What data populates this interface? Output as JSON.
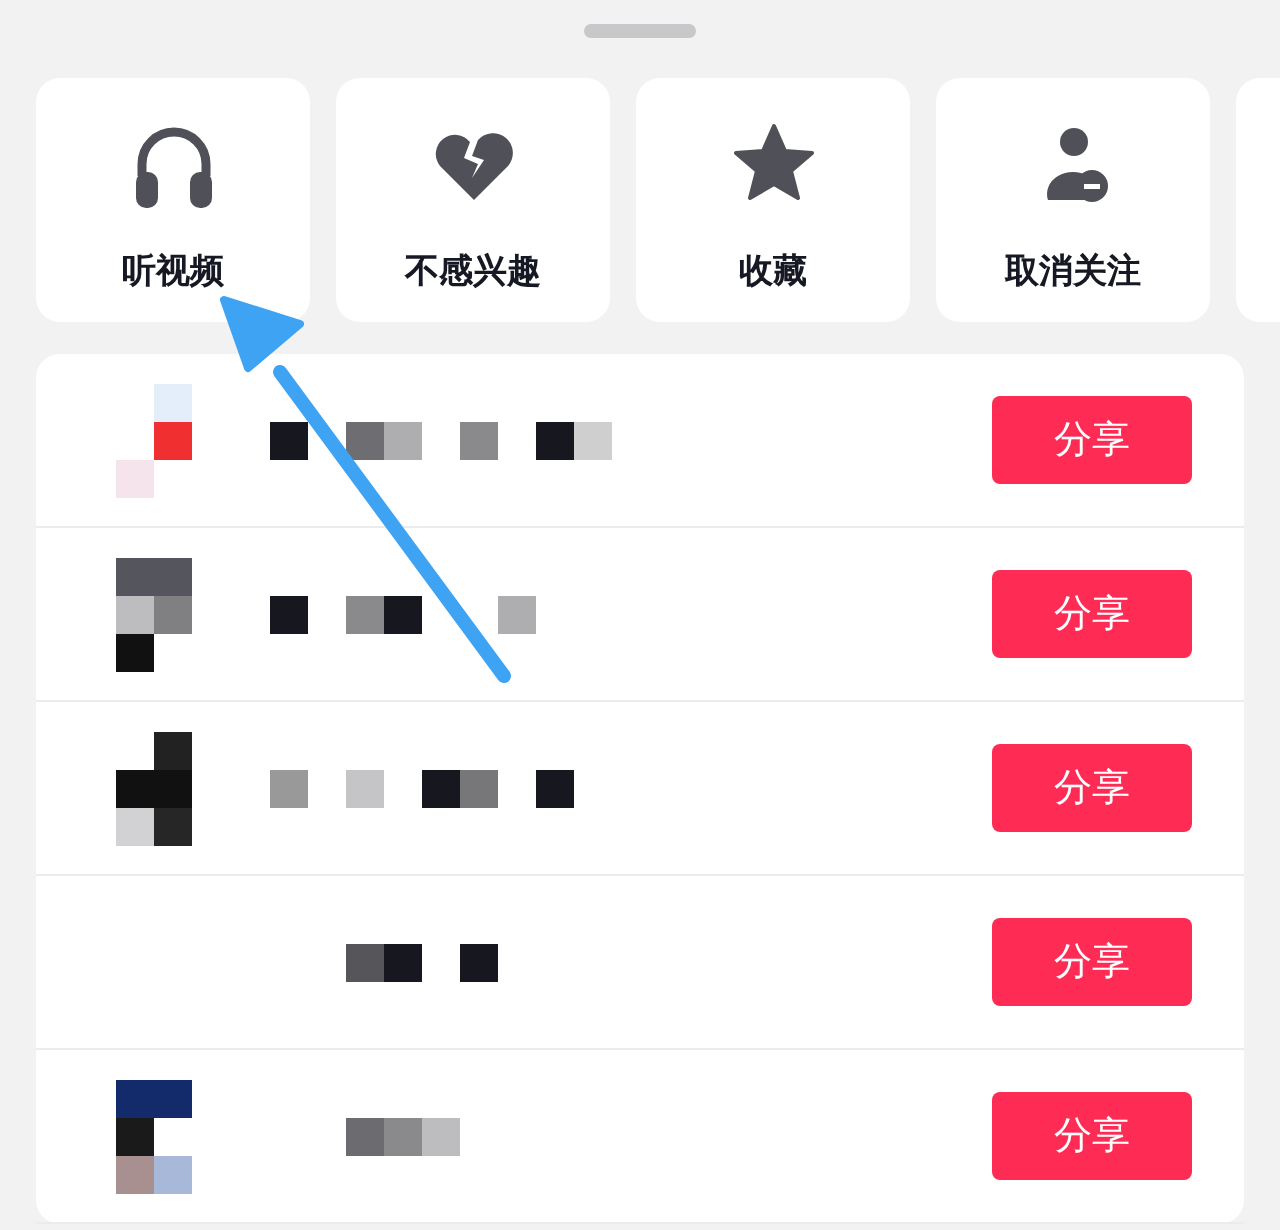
{
  "actions": [
    {
      "kind": "headphones",
      "label": "听视频"
    },
    {
      "kind": "broken-heart",
      "label": "不感兴趣"
    },
    {
      "kind": "star",
      "label": "收藏"
    },
    {
      "kind": "unfollow",
      "label": "取消关注"
    }
  ],
  "contacts": [
    {
      "button": "分享"
    },
    {
      "button": "分享"
    },
    {
      "button": "分享"
    },
    {
      "button": "分享"
    },
    {
      "button": "分享"
    }
  ]
}
